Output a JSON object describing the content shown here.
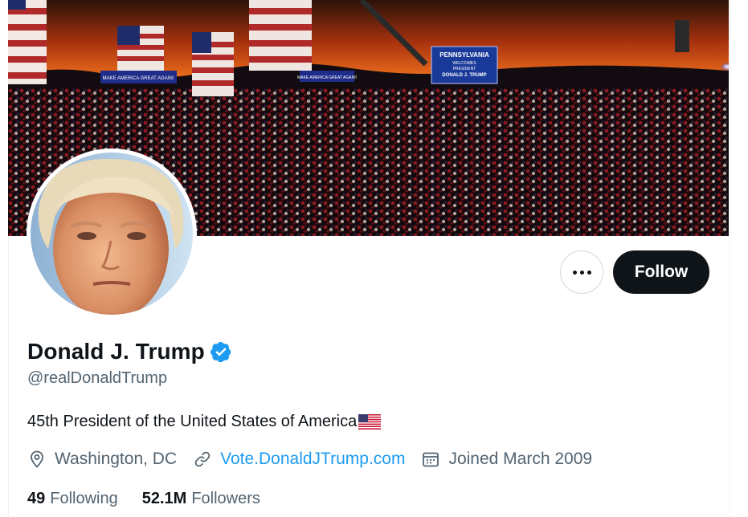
{
  "banner": {
    "sign_left": "MAKE AMERICA GREAT AGAIN!",
    "sign_mid": "MAKE AMERICA GREAT AGAIN!",
    "screen_line1": "PENNSYLVANIA",
    "screen_line2": "WELCOMES",
    "screen_line3": "PRESIDENT",
    "screen_line4": "DONALD J. TRUMP"
  },
  "profile": {
    "name": "Donald J. Trump",
    "handle": "@realDonaldTrump",
    "bio": "45th President of the United States of America",
    "location": "Washington, DC",
    "website": "Vote.DonaldJTrump.com",
    "joined": "Joined March 2009",
    "following_count": "49",
    "following_label": "Following",
    "followers_count": "52.1M",
    "followers_label": "Followers"
  },
  "actions": {
    "follow_label": "Follow"
  },
  "icons": {
    "verified": "verified-badge-icon",
    "more": "more-options-icon",
    "location": "location-pin-icon",
    "link": "link-icon",
    "calendar": "calendar-icon",
    "flag": "us-flag-emoji"
  },
  "colors": {
    "accent": "#1d9bf0",
    "text": "#0f1419",
    "secondary": "#536471",
    "follow_bg": "#0f1419"
  }
}
